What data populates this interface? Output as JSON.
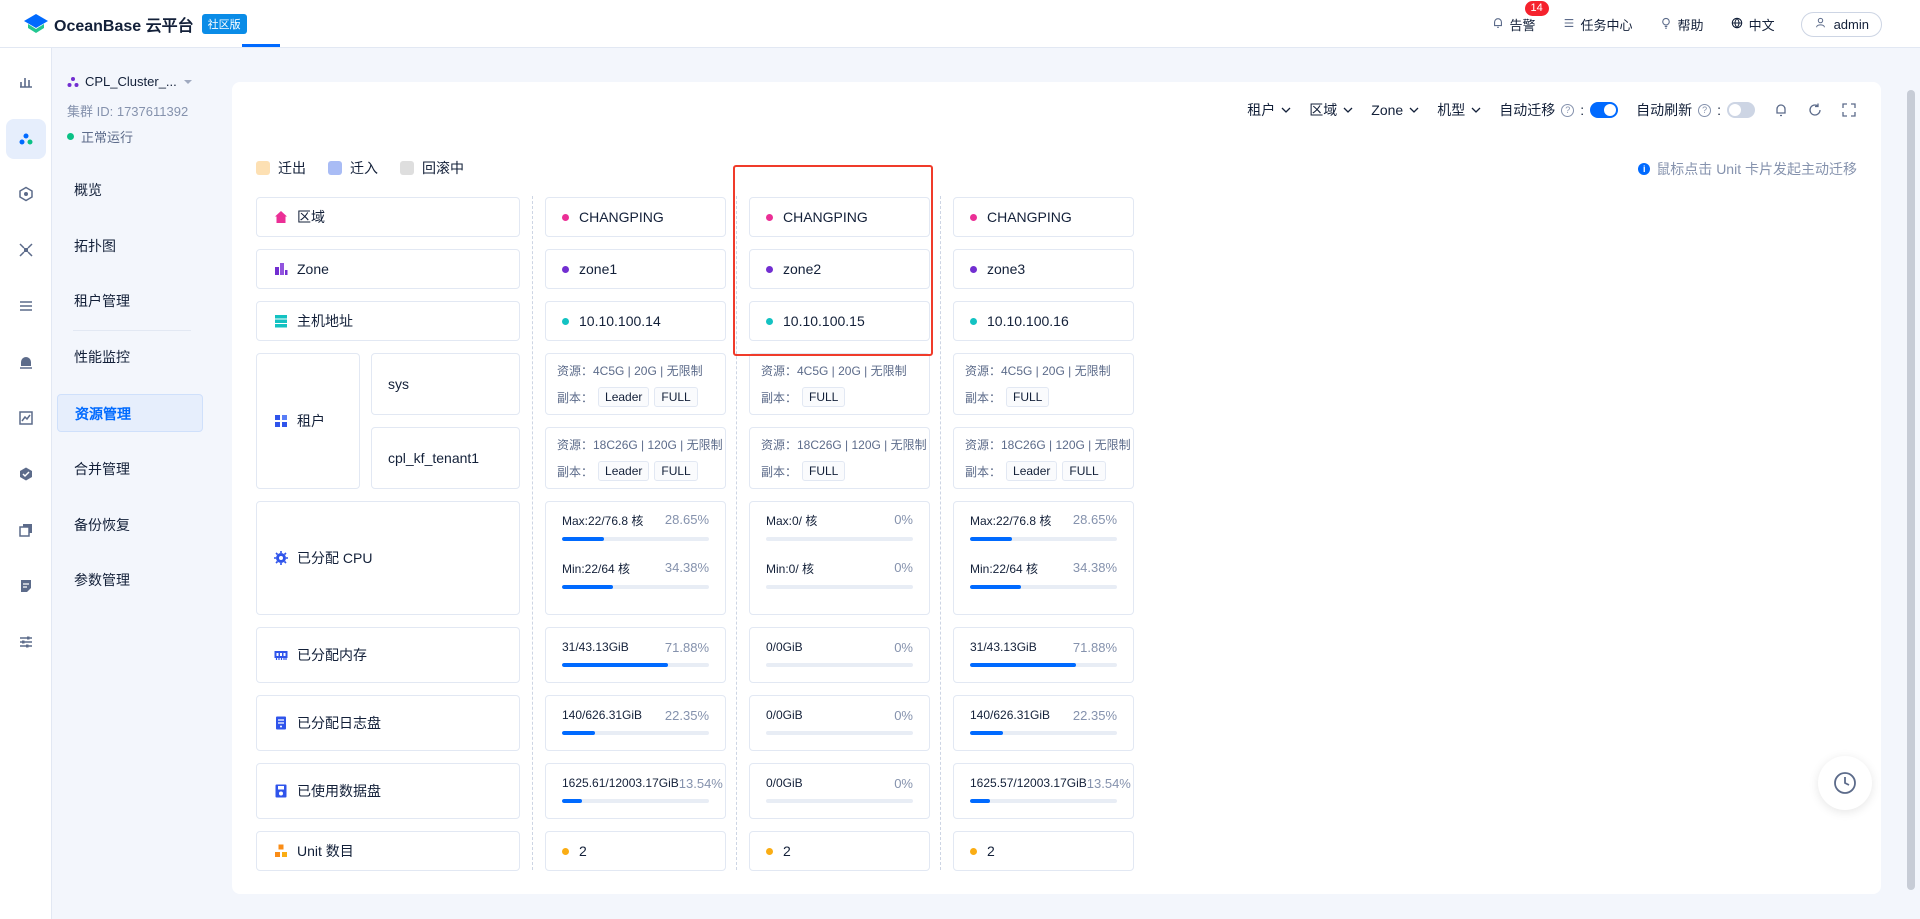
{
  "header": {
    "brand": "OceanBase 云平台",
    "edition_badge": "社区版",
    "alarm_label": "告警",
    "alarm_count": "14",
    "task_center": "任务中心",
    "help": "帮助",
    "language": "中文",
    "user": "admin"
  },
  "cluster": {
    "name": "CPL_Cluster_...",
    "id": "集群 ID: 1737611392",
    "status": "正常运行"
  },
  "nav": {
    "items": [
      {
        "label": "概览"
      },
      {
        "label": "拓扑图"
      },
      {
        "label": "租户管理"
      },
      {
        "label": "性能监控"
      },
      {
        "label": "资源管理"
      },
      {
        "label": "合并管理"
      },
      {
        "label": "备份恢复"
      },
      {
        "label": "参数管理"
      }
    ],
    "active": "资源管理"
  },
  "toolbar": {
    "tenant_filter": "租户",
    "region_filter": "区域",
    "zone_filter": "Zone",
    "model_filter": "机型",
    "auto_migrate": "自动迁移",
    "auto_migrate_on": true,
    "auto_refresh": "自动刷新",
    "auto_refresh_on": false
  },
  "legend": {
    "out": "迁出",
    "in": "迁入",
    "rollback": "回滚中",
    "colors": {
      "out": "#fde0b3",
      "in": "#a9bcf5",
      "rollback": "#dedede"
    }
  },
  "tip": "鼠标点击 Unit 卡片发起主动迁移",
  "row_labels": {
    "region": "区域",
    "zone": "Zone",
    "host": "主机地址",
    "tenant": "租户",
    "tenant_names": [
      "sys",
      "cpl_kf_tenant1"
    ],
    "cpu": "已分配 CPU",
    "memory": "已分配内存",
    "log_disk": "已分配日志盘",
    "data_disk": "已使用数据盘",
    "units": "Unit 数目"
  },
  "columns": [
    {
      "region": "CHANGPING",
      "zone": "zone1",
      "host": "10.10.100.14",
      "tenants": [
        {
          "resource": "资源：4C5G | 20G | 无限制",
          "replica_label": "副本：",
          "tags": [
            "Leader",
            "FULL"
          ]
        },
        {
          "resource": "资源：18C26G | 120G | 无限制",
          "replica_label": "副本：",
          "tags": [
            "Leader",
            "FULL"
          ]
        }
      ],
      "cpu_max": "Max:22/76.8 核",
      "cpu_max_pct": "28.65%",
      "cpu_max_frac": 0.2865,
      "cpu_min": "Min:22/64 核",
      "cpu_min_pct": "34.38%",
      "cpu_min_frac": 0.3438,
      "mem": "31/43.13GiB",
      "mem_pct": "71.88%",
      "mem_frac": 0.7188,
      "log": "140/626.31GiB",
      "log_pct": "22.35%",
      "log_frac": 0.2235,
      "data": "1625.61/12003.17GiB",
      "data_pct": "13.54%",
      "data_frac": 0.1354,
      "units": "2"
    },
    {
      "region": "CHANGPING",
      "zone": "zone2",
      "host": "10.10.100.15",
      "tenants": [
        {
          "resource": "资源：4C5G | 20G | 无限制",
          "replica_label": "副本：",
          "tags": [
            "FULL"
          ]
        },
        {
          "resource": "资源：18C26G | 120G | 无限制",
          "replica_label": "副本：",
          "tags": [
            "FULL"
          ]
        }
      ],
      "cpu_max": "Max:0/ 核",
      "cpu_max_pct": "0%",
      "cpu_max_frac": 0,
      "cpu_min": "Min:0/ 核",
      "cpu_min_pct": "0%",
      "cpu_min_frac": 0,
      "mem": "0/0GiB",
      "mem_pct": "0%",
      "mem_frac": 0,
      "log": "0/0GiB",
      "log_pct": "0%",
      "log_frac": 0,
      "data": "0/0GiB",
      "data_pct": "0%",
      "data_frac": 0,
      "units": "2"
    },
    {
      "region": "CHANGPING",
      "zone": "zone3",
      "host": "10.10.100.16",
      "tenants": [
        {
          "resource": "资源：4C5G | 20G | 无限制",
          "replica_label": "副本：",
          "tags": [
            "FULL"
          ]
        },
        {
          "resource": "资源：18C26G | 120G | 无限制",
          "replica_label": "副本：",
          "tags": [
            "Leader",
            "FULL"
          ]
        }
      ],
      "cpu_max": "Max:22/76.8 核",
      "cpu_max_pct": "28.65%",
      "cpu_max_frac": 0.2865,
      "cpu_min": "Min:22/64 核",
      "cpu_min_pct": "34.38%",
      "cpu_min_frac": 0.3438,
      "mem": "31/43.13GiB",
      "mem_pct": "71.88%",
      "mem_frac": 0.7188,
      "log": "140/626.31GiB",
      "log_pct": "22.35%",
      "log_frac": 0.2235,
      "data": "1625.57/12003.17GiB",
      "data_pct": "13.54%",
      "data_frac": 0.1354,
      "units": "2"
    }
  ],
  "colors": {
    "accent": "#006aff",
    "region_dot": "#eb2f96",
    "zone_dot": "#722ed1",
    "host_dot": "#13c2c2",
    "unit_dot": "#faad14",
    "highlight_box": "#f03b2a"
  }
}
